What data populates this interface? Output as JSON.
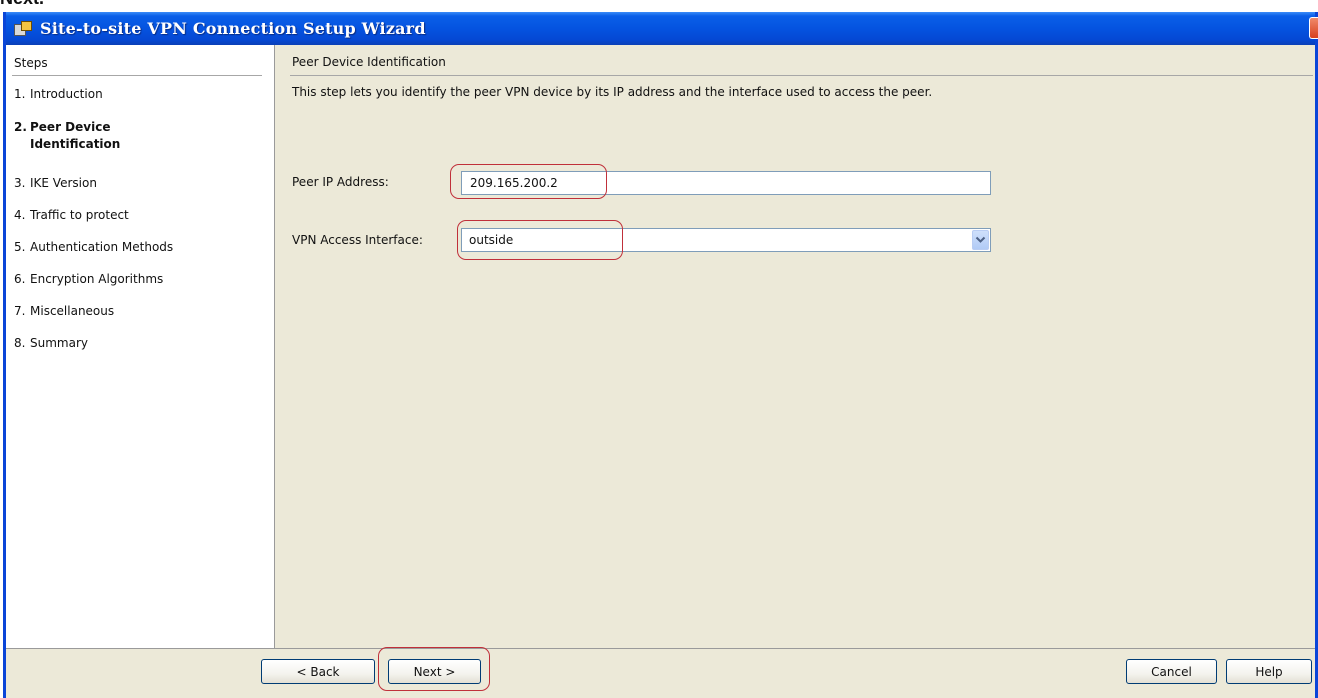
{
  "above_text": "Next.",
  "window": {
    "title": "Site-to-site VPN Connection Setup Wizard"
  },
  "steps": {
    "header": "Steps",
    "items": [
      {
        "num": "1.",
        "label": "Introduction"
      },
      {
        "num": "2.",
        "label_line1": "Peer Device",
        "label_line2": "Identification"
      },
      {
        "num": "3.",
        "label": "IKE Version"
      },
      {
        "num": "4.",
        "label": "Traffic to protect"
      },
      {
        "num": "5.",
        "label": "Authentication Methods"
      },
      {
        "num": "6.",
        "label": "Encryption Algorithms"
      },
      {
        "num": "7.",
        "label": "Miscellaneous"
      },
      {
        "num": "8.",
        "label": "Summary"
      }
    ]
  },
  "main": {
    "section_title": "Peer Device Identification",
    "description": "This step lets you identify the peer VPN device by its IP address and the interface used to access the peer.",
    "peer_ip_label": "Peer IP Address:",
    "peer_ip_value": "209.165.200.2",
    "vpn_interface_label": "VPN Access Interface:",
    "vpn_interface_value": "outside"
  },
  "buttons": {
    "back": "< Back",
    "next": "Next >",
    "cancel": "Cancel",
    "help": "Help"
  },
  "colors": {
    "titlebar": "#0553e0",
    "window_bg": "#ece9d8",
    "highlight": "#c0303a"
  },
  "icons": {
    "title": "wizard-app-icon",
    "dropdown": "chevron-down-icon"
  }
}
